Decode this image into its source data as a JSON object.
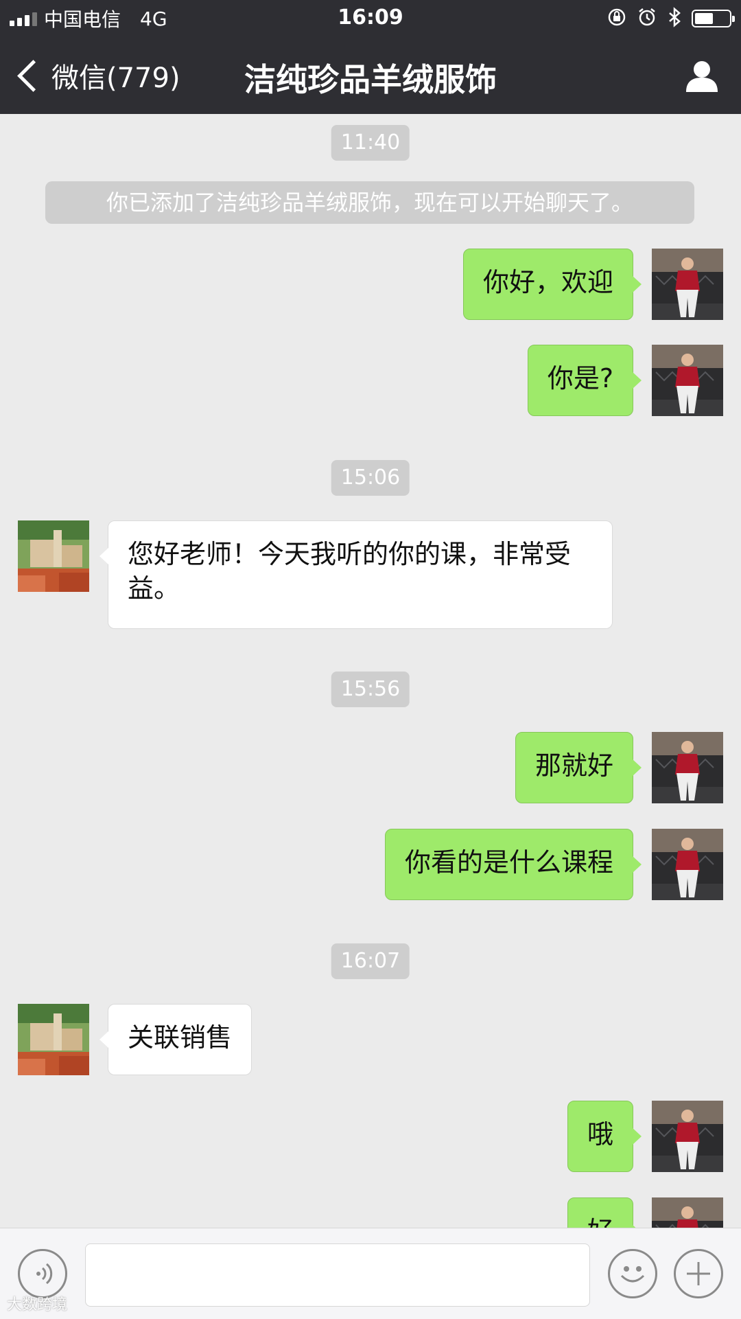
{
  "status_bar": {
    "carrier": "中国电信",
    "network": "4G",
    "time": "16:09",
    "battery_level": 0.55
  },
  "nav": {
    "back_label": "微信(779)",
    "title": "洁纯珍品羊绒服饰"
  },
  "chat": {
    "system_notice": "你已添加了洁纯珍品羊绒服饰，现在可以开始聊天了。",
    "timestamps": [
      "11:40",
      "15:06",
      "15:56",
      "16:07"
    ],
    "messages": [
      {
        "sender": "self",
        "text": "你好，欢迎"
      },
      {
        "sender": "self",
        "text": "你是?"
      },
      {
        "sender": "peer",
        "text": "您好老师！今天我听的你的课，非常受益。"
      },
      {
        "sender": "self",
        "text": "那就好"
      },
      {
        "sender": "self",
        "text": "你看的是什么课程"
      },
      {
        "sender": "peer",
        "text": "关联销售"
      },
      {
        "sender": "self",
        "text": "哦"
      },
      {
        "sender": "self",
        "text": "好"
      }
    ]
  },
  "input_bar": {
    "value": "",
    "voice_icon": "voice-icon",
    "emoji_icon": "emoji-icon",
    "plus_icon": "plus-icon"
  },
  "watermark": "大数跨境",
  "colors": {
    "nav_background": "#2e2e33",
    "chat_background": "#ebebeb",
    "self_bubble": "#9eea6a",
    "peer_bubble": "#ffffff",
    "timestamp_chip": "#cecece"
  }
}
